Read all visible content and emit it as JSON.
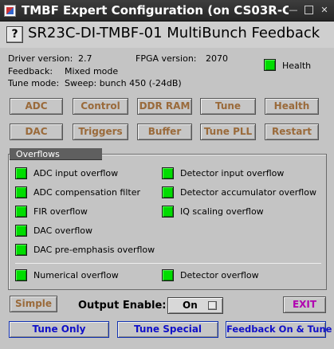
{
  "window": {
    "title": "TMBF Expert Configuration (on CS03R-CS-S",
    "minimize_glyph": "—",
    "close_glyph": "✕"
  },
  "header": {
    "help_label": "?",
    "device_title": "SR23C-DI-TMBF-01 MultiBunch Feedback"
  },
  "info": {
    "driver_version_label": "Driver version:",
    "driver_version": "2.7",
    "fpga_version_label": "FPGA version:",
    "fpga_version": "2070",
    "feedback_label": "Feedback:",
    "feedback": "Mixed mode",
    "tune_mode_label": "Tune mode:",
    "tune_mode": "Sweep: bunch 450 (-24dB)",
    "health_label": "Health",
    "health_color": "#00dd00"
  },
  "nav_buttons": {
    "row1": [
      "ADC",
      "Control",
      "DDR RAM",
      "Tune",
      "Health"
    ],
    "row2": [
      "DAC",
      "Triggers",
      "Buffer",
      "Tune PLL",
      "Restart"
    ]
  },
  "overflows": {
    "title": "Overflows",
    "left": [
      "ADC input overflow",
      "ADC compensation filter",
      "FIR overflow",
      "DAC overflow",
      "DAC pre-emphasis overflow"
    ],
    "right": [
      "Detector input overflow",
      "Detector accumulator overflow",
      "IQ scaling overflow"
    ],
    "bottom_left": "Numerical overflow",
    "bottom_right": "Detector overflow"
  },
  "controls": {
    "simple_label": "Simple",
    "output_enable_label": "Output Enable:",
    "output_enable_value": "On",
    "exit_label": "EXIT",
    "tune_only_label": "Tune Only",
    "tune_special_label": "Tune Special",
    "feedback_on_tune_label": "Feedback On & Tune"
  }
}
